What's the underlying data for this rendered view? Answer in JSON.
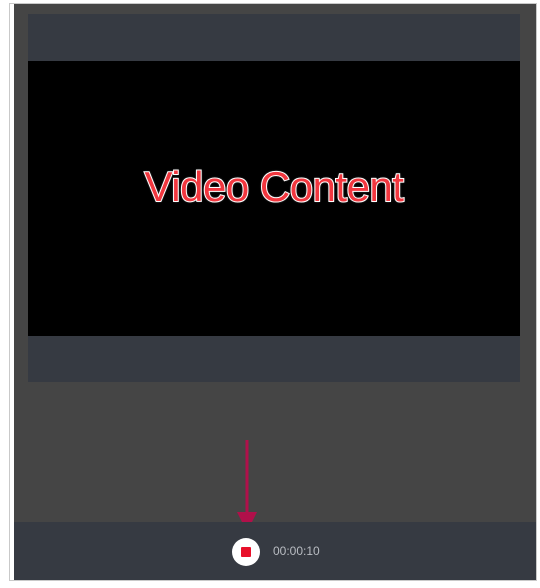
{
  "video": {
    "overlay_text": "Video Content"
  },
  "controls": {
    "record_state": "recording",
    "timer": "00:00:10"
  },
  "colors": {
    "recorder_bg": "#454545",
    "panel_bg": "#363a42",
    "video_bg": "#000000",
    "text_red": "#f2373f",
    "stop_red": "#e8102a",
    "arrow": "#b0104a"
  },
  "icons": {
    "record_button": "stop-square-icon",
    "annotation": "arrow-down-icon"
  }
}
